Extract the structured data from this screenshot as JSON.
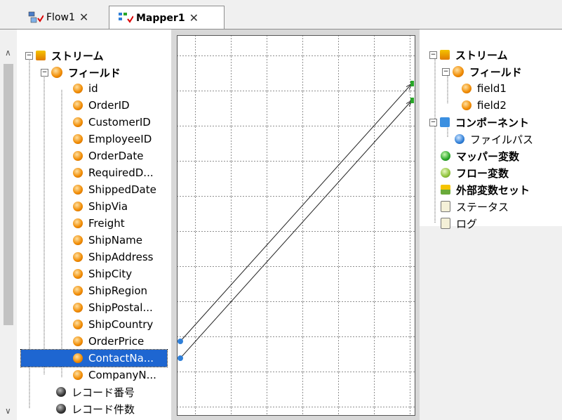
{
  "tabs": [
    {
      "label": "Flow1",
      "close": "✕"
    },
    {
      "label": "Mapper1",
      "close": "✕"
    }
  ],
  "left_tree": {
    "root": "ストリーム",
    "fields": "フィールド",
    "items": [
      "id",
      "OrderID",
      "CustomerID",
      "EmployeeID",
      "OrderDate",
      "RequiredD...",
      "ShippedDate",
      "ShipVia",
      "Freight",
      "ShipName",
      "ShipAddress",
      "ShipCity",
      "ShipRegion",
      "ShipPostal...",
      "ShipCountry",
      "OrderPrice",
      "ContactNa...",
      "CompanyN..."
    ],
    "record_number": "レコード番号",
    "record_count": "レコード件数"
  },
  "right_tree": {
    "root": "ストリーム",
    "fields": "フィールド",
    "field_items": [
      "field1",
      "field2"
    ],
    "component": "コンポーネント",
    "file_path": "ファイルパス",
    "mapper_var": "マッパー変数",
    "flow_var": "フロー変数",
    "external_var_set": "外部変数セット",
    "status": "ステータス",
    "log": "ログ"
  },
  "colors": {
    "selection": "#1e66d1",
    "accent": "#f08a00"
  }
}
